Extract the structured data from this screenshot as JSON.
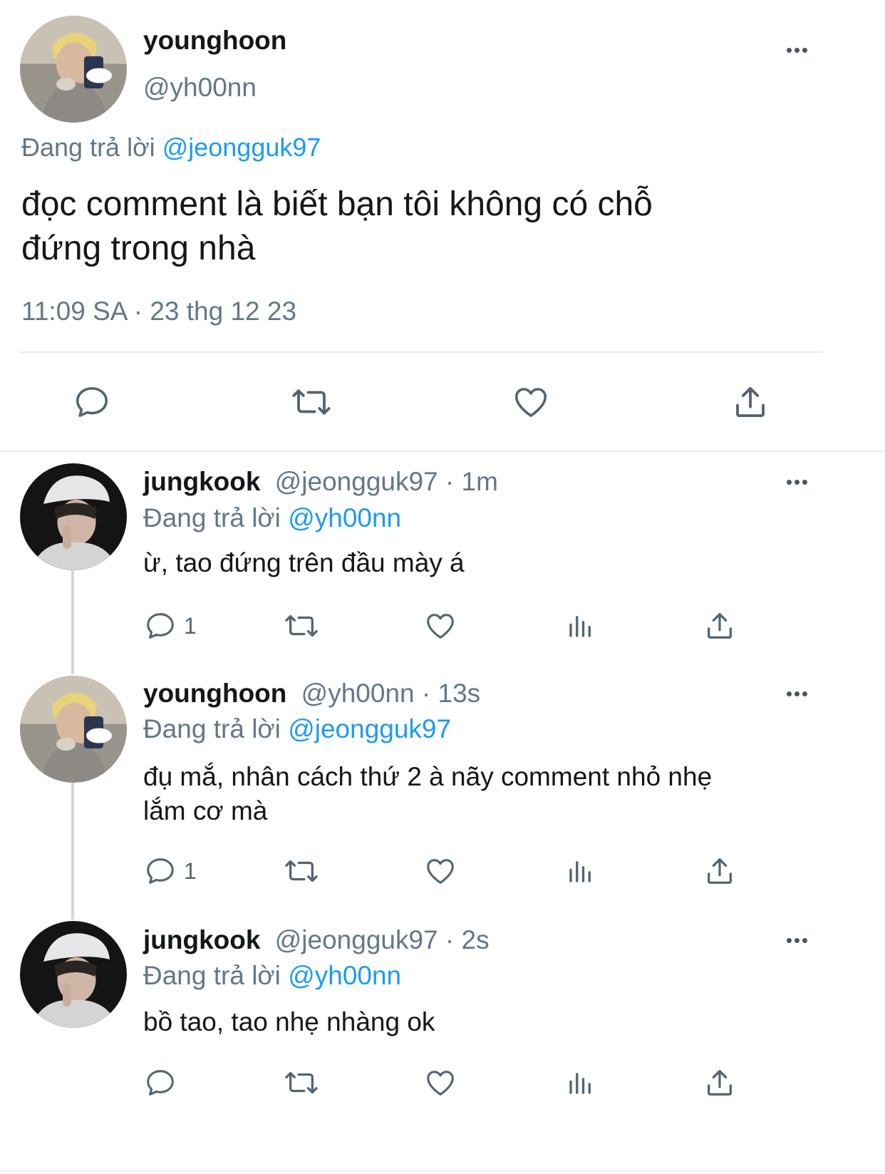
{
  "main_tweet": {
    "display_name": "younghoon",
    "handle": "@yh00nn",
    "reply_prefix": "Đang trả lời",
    "reply_to": "@jeongguk97",
    "text_line1": "đọc comment là biết bạn tôi không có chỗ",
    "text_line2": "đứng trong nhà",
    "timestamp": "11:09 SA · 23 thg 12 23"
  },
  "replies": [
    {
      "display_name": "jungkook",
      "meta": "@jeongguk97 · 1m",
      "reply_prefix": "Đang trả lời",
      "reply_to": "@yh00nn",
      "text": "ừ, tao đứng trên đầu mày á",
      "reply_count": "1"
    },
    {
      "display_name": "younghoon",
      "meta": "@yh00nn · 13s",
      "reply_prefix": "Đang trả lời",
      "reply_to": "@jeongguk97",
      "text_line1": "đụ mắ, nhân cách thứ 2 à nãy comment nhỏ nhẹ",
      "text_line2": "lắm cơ mà",
      "reply_count": "1"
    },
    {
      "display_name": "jungkook",
      "meta": "@jeongguk97 · 2s",
      "reply_prefix": "Đang trả lời",
      "reply_to": "@yh00nn",
      "text": "bồ tao, tao nhẹ nhàng ok",
      "reply_count": ""
    }
  ],
  "icons": {
    "reply": "speech-bubble-icon",
    "retweet": "retweet-arrows-icon",
    "like": "heart-icon",
    "views": "bar-chart-icon",
    "share": "upload-share-icon",
    "more": "ellipsis-icon"
  },
  "colors": {
    "link_blue": "#1d9bf0",
    "secondary_text": "#657786",
    "icon_grey": "#536471"
  }
}
